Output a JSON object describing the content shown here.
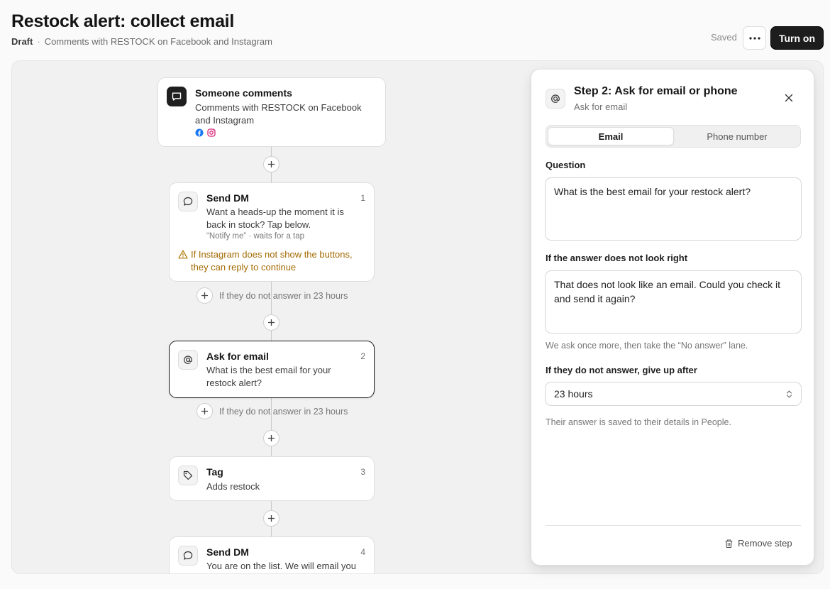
{
  "header": {
    "title": "Restock alert: collect email",
    "status": "Draft",
    "subtitle": "Comments with RESTOCK on Facebook and Instagram",
    "saved_label": "Saved",
    "more_label": "···",
    "turn_on_label": "Turn on"
  },
  "flow": {
    "trigger": {
      "title": "Someone comments",
      "body_line1": "Comments with RESTOCK on Facebook",
      "body_line2": "and Instagram",
      "icons": [
        "facebook-icon",
        "instagram-icon"
      ]
    },
    "steps": [
      {
        "num": "1",
        "title": "Send DM",
        "icon": "chat-bubble-icon",
        "body_line1": "Want a heads-up the moment it is",
        "body_line2": "back in stock? Tap below.",
        "meta": "“Notify me” · waits for a tap",
        "warning_line1": "If Instagram does not show the buttons,",
        "warning_line2": "they can reply to continue",
        "no_answer": "If they do not answer in 23 hours"
      },
      {
        "num": "2",
        "title": "Ask for email",
        "icon": "at-sign-icon",
        "body_line1": "What is the best email for your",
        "body_line2": "restock alert?",
        "no_answer": "If they do not answer in 23 hours"
      },
      {
        "num": "3",
        "title": "Tag",
        "icon": "tag-icon",
        "body_line1": "Adds restock"
      },
      {
        "num": "4",
        "title": "Send DM",
        "icon": "chat-bubble-icon",
        "body_line1": "You are on the list. We will email you"
      }
    ]
  },
  "panel": {
    "title": "Step 2: Ask for email or phone",
    "subtitle": "Ask for email",
    "tabs": [
      {
        "label": "Email",
        "active": true
      },
      {
        "label": "Phone number",
        "active": false
      }
    ],
    "question_label": "Question",
    "question_value": "What is the best email for your restock alert?",
    "retry_label": "If the answer does not look right",
    "retry_value": "That does not look like an email. Could you check it and send it again?",
    "retry_hint": "We ask once more, then take the “No answer” lane.",
    "giveup_label": "If they do not answer, give up after",
    "giveup_value": "23 hours",
    "saved_hint": "Their answer is saved to their details in People.",
    "remove_label": "Remove step"
  },
  "colors": {
    "accent_dark": "#1d1d1d",
    "warning": "#a36a00",
    "facebook": "#1877f2",
    "instagram": "#d6287a"
  }
}
